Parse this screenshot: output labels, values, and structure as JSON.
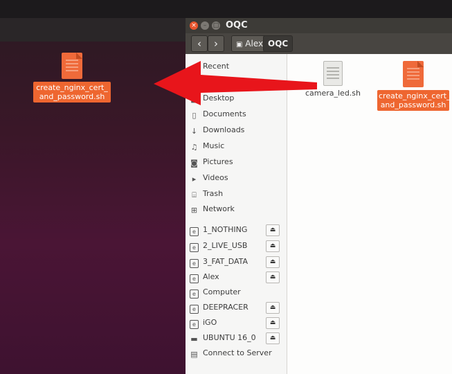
{
  "desktop": {
    "icon_label": "create_nginx_cert_\nand_password.sh"
  },
  "window": {
    "title": "OQC",
    "breadcrumbs": [
      "Alex",
      "OQC"
    ]
  },
  "sidebar": {
    "items": [
      {
        "label": "Recent",
        "icon": "clock-icon"
      },
      {
        "label": "Desktop",
        "icon": "folder-icon"
      },
      {
        "label": "Documents",
        "icon": "document-icon"
      },
      {
        "label": "Downloads",
        "icon": "download-icon"
      },
      {
        "label": "Music",
        "icon": "music-icon"
      },
      {
        "label": "Pictures",
        "icon": "camera-icon"
      },
      {
        "label": "Videos",
        "icon": "video-icon"
      },
      {
        "label": "Trash",
        "icon": "trash-icon"
      },
      {
        "label": "Network",
        "icon": "network-icon"
      },
      {
        "label": "1_NOTHING",
        "icon": "drive-icon",
        "eject": true
      },
      {
        "label": "2_LIVE_USB",
        "icon": "drive-icon",
        "eject": true
      },
      {
        "label": "3_FAT_DATA",
        "icon": "drive-icon",
        "eject": true
      },
      {
        "label": "Alex",
        "icon": "drive-icon",
        "eject": true
      },
      {
        "label": "Computer",
        "icon": "drive-icon",
        "eject": false
      },
      {
        "label": "DEEPRACER",
        "icon": "drive-icon",
        "eject": true
      },
      {
        "label": "iGO",
        "icon": "drive-icon",
        "eject": true
      },
      {
        "label": "UBUNTU 16_0",
        "icon": "harddisk-icon",
        "eject": true
      },
      {
        "label": "Connect to Server",
        "icon": "server-icon"
      }
    ]
  },
  "files": [
    {
      "name": "camera_led.sh",
      "selected": false
    },
    {
      "name": "create_nginx_cert_\nand_password.sh",
      "selected": true
    }
  ],
  "colors": {
    "accent": "#ee6630",
    "arrow": "#e8151b"
  }
}
